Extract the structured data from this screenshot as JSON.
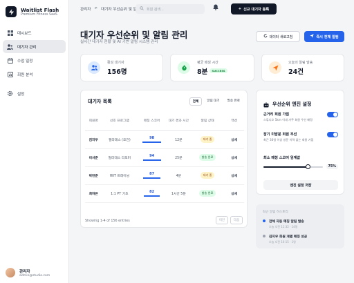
{
  "brand": {
    "name": "Waitlist Flash",
    "subtitle": "Premium Fitness SaaS",
    "logo": "lightning-icon"
  },
  "sidebar": {
    "items": [
      {
        "label": "대시보드",
        "icon": "grid-icon"
      },
      {
        "label": "대기자 관리",
        "icon": "users-icon",
        "active": true
      },
      {
        "label": "수업 일정",
        "icon": "calendar-icon"
      },
      {
        "label": "회원 분석",
        "icon": "chart-icon"
      }
    ],
    "settings": {
      "label": "설정",
      "icon": "gear-icon"
    }
  },
  "user": {
    "name": "관리자",
    "email": "admin@studio.com"
  },
  "topbar": {
    "breadcrumb": [
      "관리자",
      ">",
      "대기자 우선순위 및 알림 관리"
    ],
    "search_placeholder": "회원 검색...",
    "new_button": "신규 대기자 등록"
  },
  "header": {
    "title": "대기자 우선순위 및 알림 관리",
    "subtitle": "실시간 대기자 현황 및 AI 기반 알림 시스템 관리",
    "refresh_button": "데이터 새로고침",
    "send_button": "즉시 전체 알림"
  },
  "stats": [
    {
      "label": "활성 대기자",
      "value": "156명",
      "icon": "users-icon",
      "color": "#2563eb"
    },
    {
      "label": "평균 매칭 시간",
      "value": "8분",
      "badge": "SUCCESS",
      "icon": "stopwatch-icon",
      "color": "#16a34a"
    },
    {
      "label": "오늘의 알림 발송",
      "value": "24건",
      "icon": "send-icon",
      "color": "#f97316"
    }
  ],
  "waitlist": {
    "title": "대기자 목록",
    "tabs": [
      "전체",
      "알림 대기",
      "발송 완료"
    ],
    "columns": [
      "회원명",
      "선호 프로그램",
      "매칭 스코어",
      "대기 경과 시간",
      "알림 상태",
      "액션"
    ],
    "rows": [
      {
        "name": "김지우",
        "program": "필라테스 (오전)",
        "score": "98",
        "score_fraction": 0.98,
        "elapsed": "12분",
        "status": "대기 중",
        "status_type": "wait",
        "action": "상세"
      },
      {
        "name": "이서준",
        "program": "필라테스 리포머",
        "score": "94",
        "score_fraction": 0.94,
        "elapsed": "25분",
        "status": "발송 완료",
        "status_type": "sent",
        "action": "상세"
      },
      {
        "name": "박민준",
        "program": "HIIT 트레이닝",
        "score": "87",
        "score_fraction": 0.87,
        "elapsed": "4분",
        "status": "대기 중",
        "status_type": "wait",
        "action": "상세"
      },
      {
        "name": "최하은",
        "program": "1:1 PT 기초",
        "score": "82",
        "score_fraction": 0.82,
        "elapsed": "1시간 5분",
        "status": "발송 완료",
        "status_type": "sent",
        "action": "상세"
      }
    ],
    "footer": "Showing 1-4 of 156 entries",
    "prev": "이전",
    "next": "다음"
  },
  "engine": {
    "title": "우선순위 엔진 설정",
    "icon": "robot-icon",
    "settings": [
      {
        "label": "근거리 회원 가점",
        "desc": "스튜디오 5km 이내 거주 회원 우선 배정",
        "enabled": true
      },
      {
        "label": "장기 미방문 회원 우선",
        "desc": "최근 30일 이상 방문 이력 없는 회원 가점",
        "enabled": true
      }
    ],
    "threshold_label": "최소 매칭 스코어 임계값",
    "threshold_value": "75%",
    "threshold_fraction": 0.75,
    "save_button": "엔진 설정 저장"
  },
  "history": {
    "title": "최근 알림 히스토리",
    "items": [
      {
        "main": "전체 자동 매칭 알림 발송",
        "sub": "오늘 오전 11:32 · 14명",
        "color": "#2563eb"
      },
      {
        "main": "김지우 회원 개별 매칭 성공",
        "sub": "오늘 오전 10:15 · 1명",
        "color": "#9ca3af"
      }
    ]
  }
}
